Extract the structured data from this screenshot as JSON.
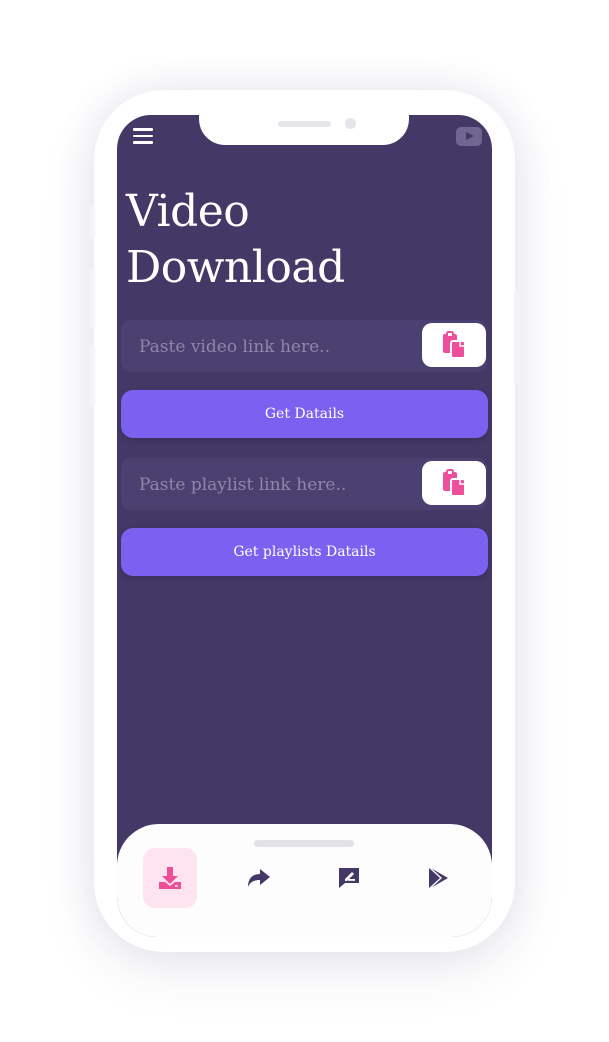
{
  "header": {
    "menu_icon": "hamburger-menu-icon",
    "youtube_icon": "youtube-icon"
  },
  "title": {
    "line1": "Video",
    "line2": "Download"
  },
  "video_section": {
    "input_placeholder": "Paste video link here..",
    "input_value": "",
    "paste_icon": "clipboard-paste-icon",
    "button_label": "Get Datails"
  },
  "playlist_section": {
    "input_placeholder": "Paste playlist link here..",
    "input_value": "",
    "paste_icon": "clipboard-paste-icon",
    "button_label": "Get playlists Datails"
  },
  "bottom_nav": {
    "items": [
      {
        "icon": "download-icon",
        "active": true
      },
      {
        "icon": "share-icon",
        "active": false
      },
      {
        "icon": "feedback-icon",
        "active": false
      },
      {
        "icon": "play-store-icon",
        "active": false
      }
    ]
  },
  "colors": {
    "screen_bg": "#433866",
    "accent": "#7b61f0",
    "pink": "#ef4f9a",
    "active_nav_bg": "#fde4ef",
    "nav_icon": "#433866"
  }
}
